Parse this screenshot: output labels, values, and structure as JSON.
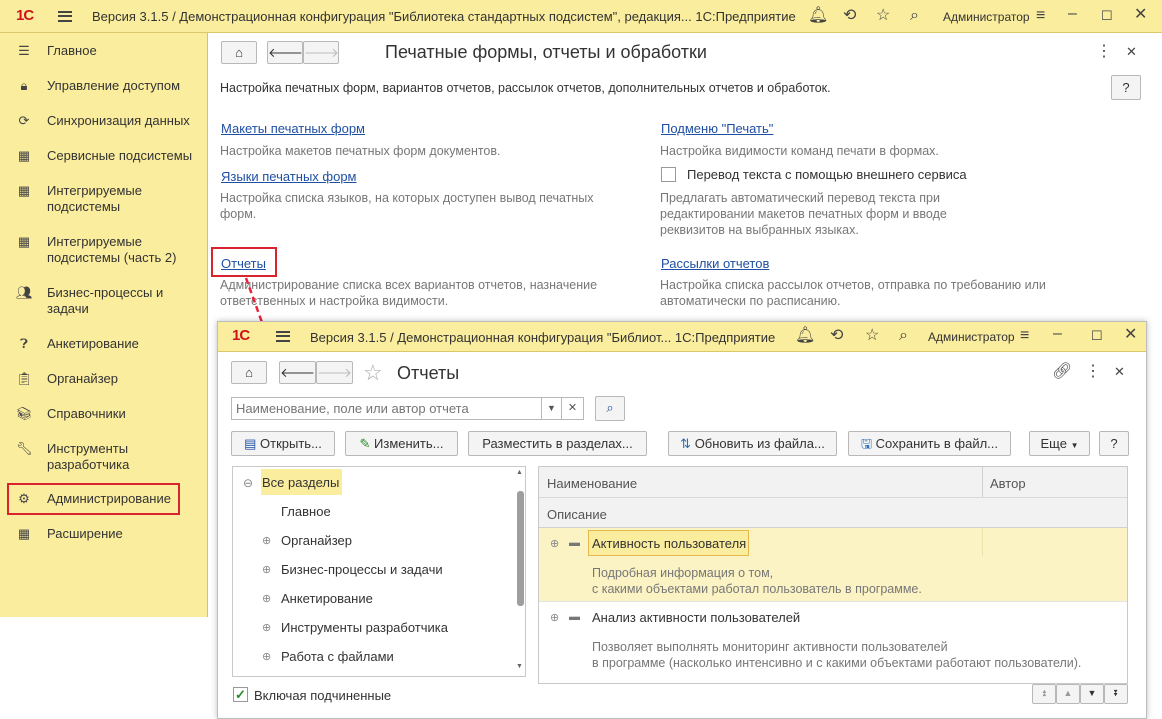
{
  "topbar": {
    "logo": "1С",
    "title": "Версия 3.1.5 / Демонстрационная конфигурация \"Библиотека стандартных подсистем\", редакция... 1С:Предприятие",
    "user": "Администратор"
  },
  "sidebar": {
    "items": [
      {
        "label": "Главное",
        "icon": "menu-icon"
      },
      {
        "label": "Управление доступом",
        "icon": "lock-icon"
      },
      {
        "label": "Синхронизация данных",
        "icon": "sync-icon"
      },
      {
        "label": "Сервисные подсистемы",
        "icon": "grid-icon"
      },
      {
        "label": "Интегрируемые подсистемы",
        "icon": "grid-icon"
      },
      {
        "label": "Интегрируемые подсистемы (часть 2)",
        "icon": "grid-icon"
      },
      {
        "label": "Бизнес-процессы и задачи",
        "icon": "people-icon"
      },
      {
        "label": "Анкетирование",
        "icon": "question-icon"
      },
      {
        "label": "Органайзер",
        "icon": "notebook-icon"
      },
      {
        "label": "Справочники",
        "icon": "books-icon"
      },
      {
        "label": "Инструменты разработчика",
        "icon": "wrench-icon"
      },
      {
        "label": "Администрирование",
        "icon": "gear-icon"
      },
      {
        "label": "Расширение",
        "icon": "grid-icon"
      }
    ]
  },
  "page": {
    "title": "Печатные формы, отчеты и обработки",
    "description": "Настройка печатных форм, вариантов отчетов, рассылок отчетов, дополнительных отчетов и обработок.",
    "help": "?",
    "links": {
      "print_layouts": "Макеты печатных форм",
      "print_layouts_desc": "Настройка макетов печатных форм документов.",
      "print_languages": "Языки печатных форм",
      "print_languages_desc": "Настройка списка языков, на которых доступен вывод печатных форм.",
      "reports": "Отчеты",
      "reports_desc": "Администрирование списка всех вариантов отчетов, назначение ответственных и настройка видимости.",
      "print_submenu": "Подменю \"Печать\"",
      "print_submenu_desc": "Настройка видимости команд печати в формах.",
      "translate_checkbox": "Перевод текста с помощью внешнего сервиса",
      "translate_desc": "Предлагать автоматический перевод текста при редактировании макетов печатных форм и вводе реквизитов на выбранных языках.",
      "mailing": "Рассылки отчетов",
      "mailing_desc": "Настройка списка рассылок отчетов, отправка по требованию или автоматически по расписанию."
    }
  },
  "popup": {
    "titlebar": "Версия 3.1.5 / Демонстрационная конфигурация \"Библиот...  1С:Предприятие",
    "user": "Администратор",
    "title": "Отчеты",
    "search_placeholder": "Наименование, поле или автор отчета",
    "toolbar": {
      "open": "Открыть...",
      "edit": "Изменить...",
      "place": "Разместить в разделах...",
      "update": "Обновить из файла...",
      "save": "Сохранить в файл...",
      "more": "Еще",
      "help": "?"
    },
    "tree": {
      "root": "Все разделы",
      "items": [
        "Главное",
        "Органайзер",
        "Бизнес-процессы и задачи",
        "Анкетирование",
        "Инструменты разработчика",
        "Работа с файлами"
      ]
    },
    "include_sub": "Включая подчиненные",
    "table": {
      "col_name": "Наименование",
      "col_author": "Автор",
      "col_desc": "Описание",
      "rows": [
        {
          "name": "Активность пользователя",
          "desc1": "Подробная информация о том,",
          "desc2": "с какими объектами работал пользователь в программе."
        },
        {
          "name": "Анализ активности пользователей",
          "desc1": "Позволяет выполнять мониторинг активности пользователей",
          "desc2": "в программе (насколько интенсивно и с какими объектами работают пользователи)."
        }
      ]
    }
  },
  "colors": {
    "accent": "#FBED9E",
    "highlight": "#d9232e",
    "link": "#1f4fa3"
  }
}
